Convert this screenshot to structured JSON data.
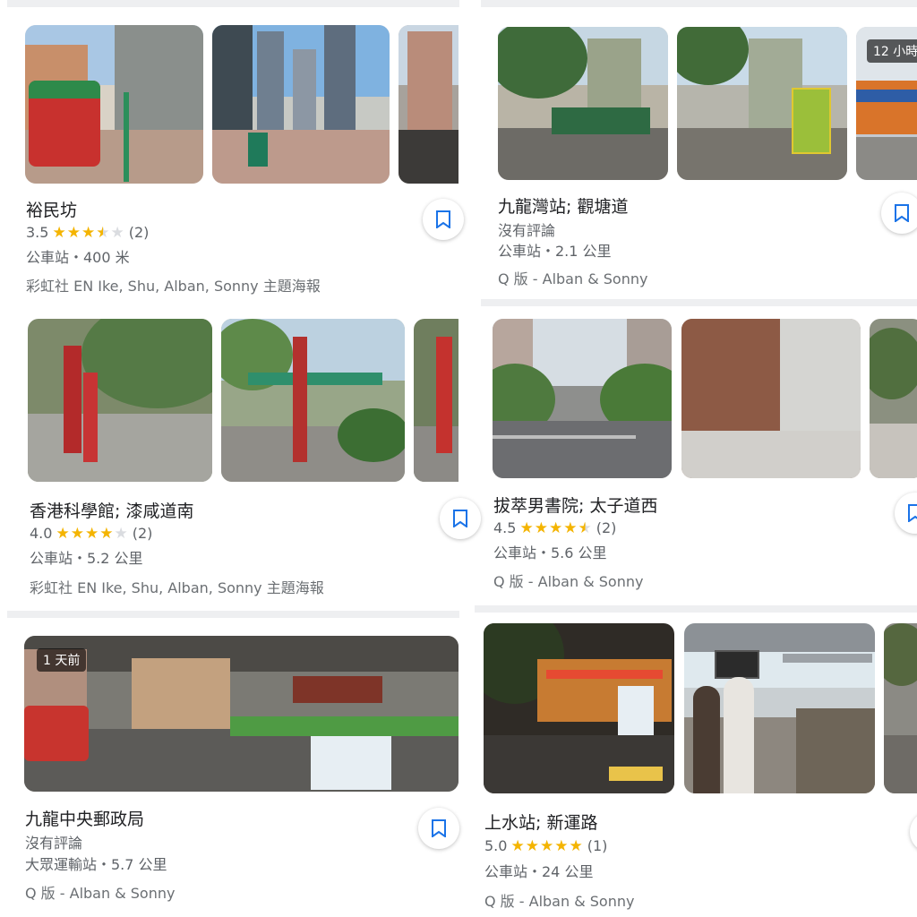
{
  "places": [
    {
      "title": "裕民坊",
      "rating": "3.5",
      "stars": 3.5,
      "reviews": "(2)",
      "meta": "公車站・400 米",
      "subtitle": "彩虹社 EN Ike, Shu, Alban, Sonny 主題海報"
    },
    {
      "title": "九龍灣站; 觀塘道",
      "no_reviews": "沒有評論",
      "meta": "公車站・2.1 公里",
      "subtitle": "Q 版 - Alban & Sonny",
      "photo_badge": "12 小時"
    },
    {
      "title": "香港科學館; 漆咸道南",
      "rating": "4.0",
      "stars": 4.0,
      "reviews": "(2)",
      "meta": "公車站・5.2 公里",
      "subtitle": "彩虹社 EN Ike, Shu, Alban, Sonny 主題海報"
    },
    {
      "title": "拔萃男書院; 太子道西",
      "rating": "4.5",
      "stars": 4.5,
      "reviews": "(2)",
      "meta": "公車站・5.6 公里",
      "subtitle": "Q 版 - Alban & Sonny"
    },
    {
      "title": "九龍中央郵政局",
      "no_reviews": "沒有評論",
      "meta": "大眾運輸站・5.7 公里",
      "subtitle": "Q 版 - Alban & Sonny",
      "photo_badge": "1 天前"
    },
    {
      "title": "上水站; 新運路",
      "rating": "5.0",
      "stars": 5.0,
      "reviews": "(1)",
      "meta": "公車站・24 公里",
      "subtitle": "Q 版 - Alban & Sonny"
    }
  ],
  "icons": {
    "save": "bookmark-icon",
    "star": "star-icon"
  },
  "colors": {
    "star": "#f4b400",
    "text": "#202124",
    "secondary": "#5f6368",
    "separator": "#eeeff1"
  }
}
